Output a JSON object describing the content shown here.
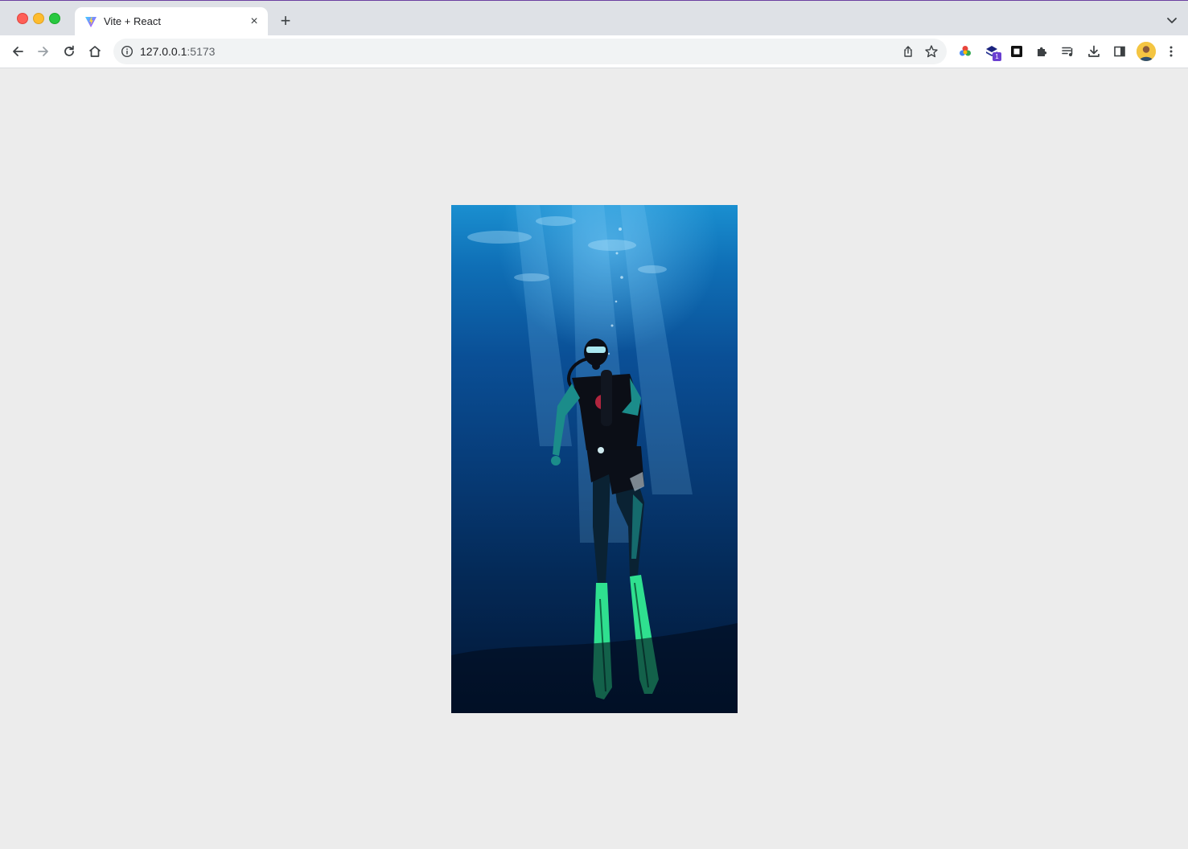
{
  "window": {
    "tab": {
      "title": "Vite + React",
      "close_label": "×"
    },
    "new_tab_label": "+"
  },
  "toolbar": {
    "url_host": "127.0.0.1",
    "url_port": ":5173"
  },
  "extensions": {
    "badge_count": "1"
  },
  "icons": {
    "back": "back-arrow-icon",
    "forward": "forward-arrow-icon",
    "reload": "reload-icon",
    "home": "home-icon",
    "info": "site-info-icon",
    "share": "share-icon",
    "star": "bookmark-star-icon",
    "color_ext": "color-picker-extension-icon",
    "stack_ext": "stack-extension-icon",
    "frame_ext": "frame-extension-icon",
    "puzzle": "extensions-puzzle-icon",
    "media": "media-controls-icon",
    "download": "download-icon",
    "sidepanel": "side-panel-icon",
    "menu": "kebab-menu-icon"
  },
  "content": {
    "image_subject": "scuba diver underwater"
  },
  "colors": {
    "titlebar": "#dee1e6",
    "page_background": "#ececec",
    "accent_purple": "#6a3fd1"
  }
}
